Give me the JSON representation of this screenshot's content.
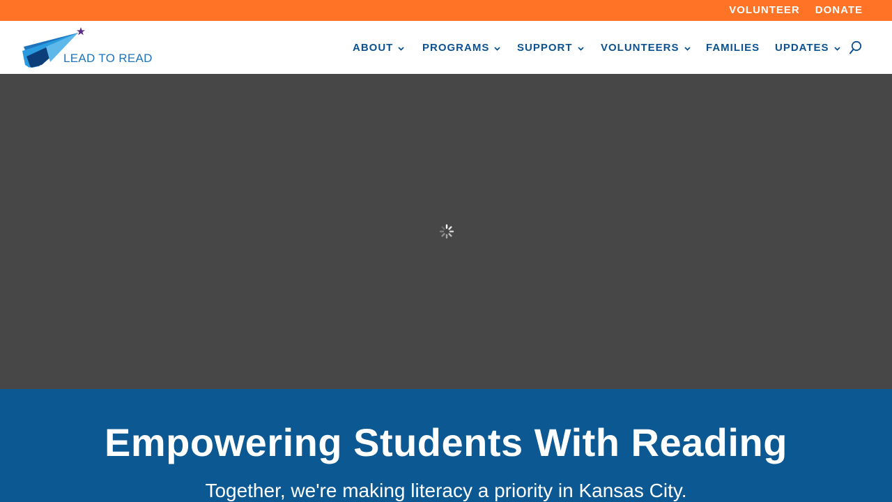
{
  "topbar": {
    "links": [
      {
        "label": "VOLUNTEER"
      },
      {
        "label": "DONATE"
      }
    ],
    "background": "#ff7326"
  },
  "header": {
    "logo": {
      "text": "LEAD TO READ",
      "icon": "paper-plane-star-logo"
    },
    "nav": [
      {
        "label": "ABOUT",
        "has_dropdown": true
      },
      {
        "label": "PROGRAMS",
        "has_dropdown": true
      },
      {
        "label": "SUPPORT",
        "has_dropdown": true
      },
      {
        "label": "VOLUNTEERS",
        "has_dropdown": true
      },
      {
        "label": "FAMILIES",
        "has_dropdown": false
      },
      {
        "label": "UPDATES",
        "has_dropdown": true
      }
    ],
    "search_icon": "search-icon",
    "nav_color": "#0c5191"
  },
  "hero": {
    "state": "loading",
    "icon": "loading-spinner-icon",
    "background": "#474747"
  },
  "banner": {
    "title": "Empowering Students With Reading",
    "subtitle": "Together, we're making literacy a priority in Kansas City.",
    "background": "#0c5893"
  }
}
